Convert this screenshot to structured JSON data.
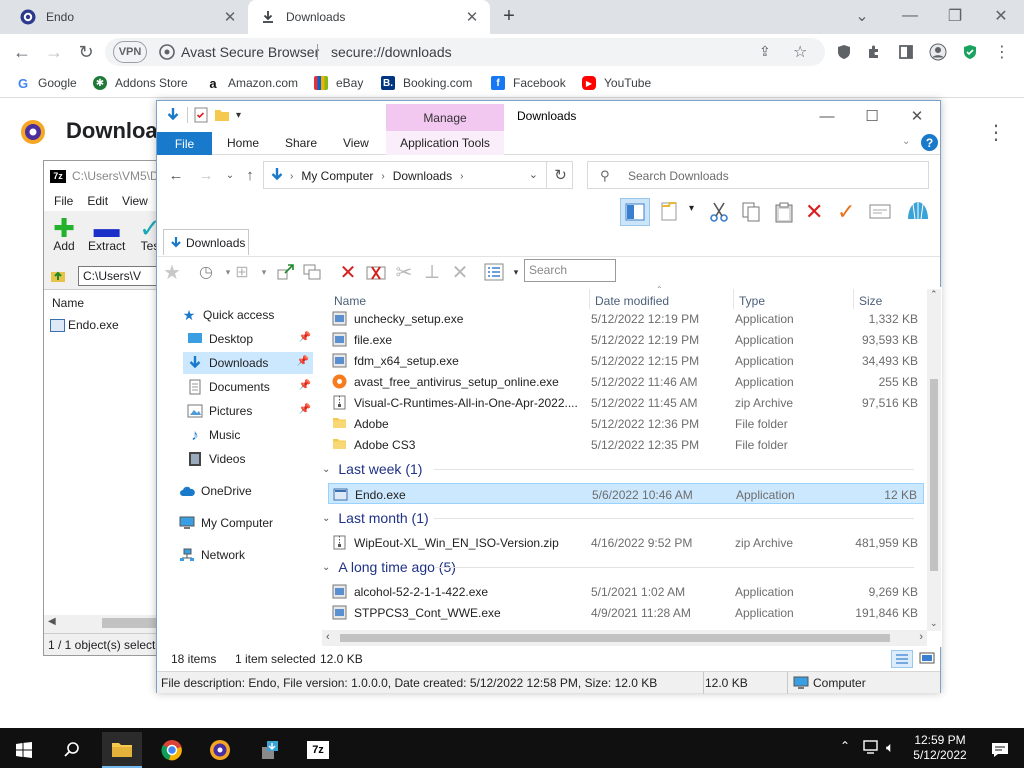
{
  "browser": {
    "tabs": [
      {
        "title": "Endo",
        "active": false
      },
      {
        "title": "Downloads",
        "active": true
      }
    ],
    "omnibox": {
      "vpn": "VPN",
      "brand": "Avast Secure Browser",
      "url": "secure://downloads"
    },
    "bookmarks": [
      "Google",
      "Addons Store",
      "Amazon.com",
      "eBay",
      "Booking.com",
      "Facebook",
      "YouTube"
    ],
    "page_title": "Downloa"
  },
  "sevenzip": {
    "title": "C:\\Users\\VM5\\D",
    "menu": [
      "File",
      "Edit",
      "View"
    ],
    "tools": [
      "Add",
      "Extract",
      "Tes"
    ],
    "address": "C:\\Users\\V",
    "column": "Name",
    "file": "Endo.exe",
    "status": "1 / 1 object(s) selecte"
  },
  "explorer": {
    "title": "Downloads",
    "ribbon": {
      "file": "File",
      "tabs": [
        "Home",
        "Share",
        "View"
      ],
      "manage": "Manage",
      "app_tools": "Application Tools"
    },
    "breadcrumb": [
      "My Computer",
      "Downloads"
    ],
    "search_placeholder": "Search Downloads",
    "folder_tab": "Downloads",
    "inline_search": "Search",
    "nav": [
      {
        "label": "Quick access",
        "icon": "star-icon"
      },
      {
        "label": "Desktop",
        "icon": "desktop-icon",
        "pinned": true
      },
      {
        "label": "Downloads",
        "icon": "download-arrow-icon",
        "pinned": true
      },
      {
        "label": "Documents",
        "icon": "documents-icon",
        "pinned": true
      },
      {
        "label": "Pictures",
        "icon": "pictures-icon",
        "pinned": true
      },
      {
        "label": "Music",
        "icon": "music-icon"
      },
      {
        "label": "Videos",
        "icon": "videos-icon"
      },
      {
        "label": "OneDrive",
        "icon": "cloud-icon"
      },
      {
        "label": "My Computer",
        "icon": "computer-icon"
      },
      {
        "label": "Network",
        "icon": "network-icon"
      }
    ],
    "columns": {
      "name": "Name",
      "date": "Date modified",
      "type": "Type",
      "size": "Size"
    },
    "files_today": [
      {
        "name": "unchecky_setup.exe",
        "date": "5/12/2022 12:19 PM",
        "type": "Application",
        "size": "1,332 KB",
        "icon": "app"
      },
      {
        "name": "file.exe",
        "date": "5/12/2022 12:19 PM",
        "type": "Application",
        "size": "93,593 KB",
        "icon": "app"
      },
      {
        "name": "fdm_x64_setup.exe",
        "date": "5/12/2022 12:15 PM",
        "type": "Application",
        "size": "34,493 KB",
        "icon": "app"
      },
      {
        "name": "avast_free_antivirus_setup_online.exe",
        "date": "5/12/2022 11:46 AM",
        "type": "Application",
        "size": "255 KB",
        "icon": "avast"
      },
      {
        "name": "Visual-C-Runtimes-All-in-One-Apr-2022....",
        "date": "5/12/2022 11:45 AM",
        "type": "zip Archive",
        "size": "97,516 KB",
        "icon": "zip"
      },
      {
        "name": "Adobe",
        "date": "5/12/2022 12:36 PM",
        "type": "File folder",
        "size": "",
        "icon": "folder"
      },
      {
        "name": "Adobe CS3",
        "date": "5/12/2022 12:35 PM",
        "type": "File folder",
        "size": "",
        "icon": "folder"
      }
    ],
    "group_last_week": "Last week (1)",
    "files_last_week": [
      {
        "name": "Endo.exe",
        "date": "5/6/2022 10:46 AM",
        "type": "Application",
        "size": "12 KB",
        "icon": "exe",
        "selected": true
      }
    ],
    "group_last_month": "Last month (1)",
    "files_last_month": [
      {
        "name": "WipEout-XL_Win_EN_ISO-Version.zip",
        "date": "4/16/2022 9:52 PM",
        "type": "zip Archive",
        "size": "481,959 KB",
        "icon": "zip"
      }
    ],
    "group_long_ago": "A long time ago (5)",
    "files_long_ago": [
      {
        "name": "alcohol-52-2-1-1-422.exe",
        "date": "5/1/2021 1:02 AM",
        "type": "Application",
        "size": "9,269 KB",
        "icon": "app"
      },
      {
        "name": "STPPCS3_Cont_WWE.exe",
        "date": "4/9/2021 11:28 AM",
        "type": "Application",
        "size": "191,846 KB",
        "icon": "app"
      }
    ],
    "status": {
      "items": "18 items",
      "selected": "1 item selected",
      "size": "12.0 KB"
    },
    "details": {
      "description": "File description: Endo, File version: 1.0.0.0, Date created: 5/12/2022 12:58 PM, Size: 12.0 KB",
      "size": "12.0 KB",
      "location": "Computer"
    }
  },
  "taskbar": {
    "time": "12:59 PM",
    "date": "5/12/2022"
  },
  "colors": {
    "accent": "#1979ca",
    "selection": "#cce8ff",
    "group_text": "#1e3287",
    "manage_tab": "#f2c7f0"
  }
}
